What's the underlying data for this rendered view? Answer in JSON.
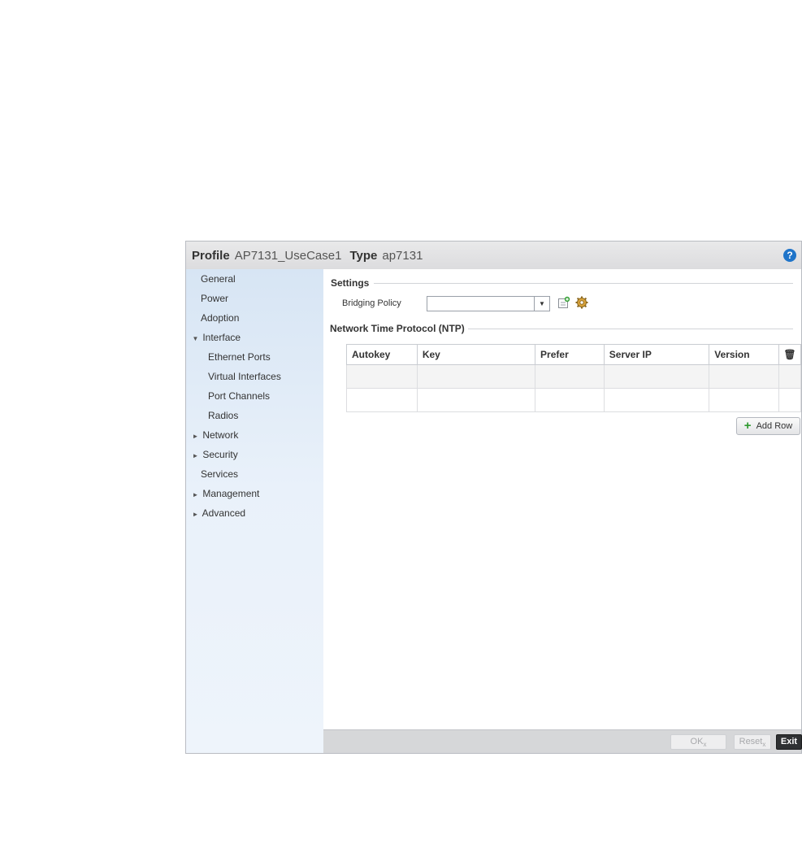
{
  "header": {
    "profile_label": "Profile",
    "profile_value": "AP7131_UseCase1",
    "type_label": "Type",
    "type_value": "ap7131",
    "help_icon": "question-icon"
  },
  "sidebar": {
    "items": [
      {
        "label": "General",
        "expander": ""
      },
      {
        "label": "Power",
        "expander": ""
      },
      {
        "label": "Adoption",
        "expander": ""
      },
      {
        "label": "Interface",
        "expander": "▼"
      },
      {
        "label": "Ethernet Ports",
        "expander": ""
      },
      {
        "label": "Virtual Interfaces",
        "expander": ""
      },
      {
        "label": "Port Channels",
        "expander": ""
      },
      {
        "label": "Radios",
        "expander": ""
      },
      {
        "label": "Network",
        "expander": "►"
      },
      {
        "label": "Security",
        "expander": "►"
      },
      {
        "label": "Services",
        "expander": ""
      },
      {
        "label": "Management",
        "expander": "►"
      },
      {
        "label": "Advanced",
        "expander": "►"
      }
    ]
  },
  "settings": {
    "title": "Settings",
    "bridging_policy_label": "Bridging Policy",
    "bridging_policy_value": "",
    "caret": "▼"
  },
  "ntp": {
    "title": "Network Time Protocol (NTP)",
    "columns": [
      "Autokey",
      "Key",
      "Prefer",
      "Server IP",
      "Version"
    ],
    "delete_icon": "🗑",
    "add_row_label": "Add Row"
  },
  "footer": {
    "ok_label": "OK",
    "reset_label": "Reset",
    "exit_label": "Exit",
    "sub_mark": "x"
  },
  "colors": {
    "accent": "#1f74c9",
    "add_green": "#2f9a2f",
    "delete_red": "#c11b1b"
  }
}
